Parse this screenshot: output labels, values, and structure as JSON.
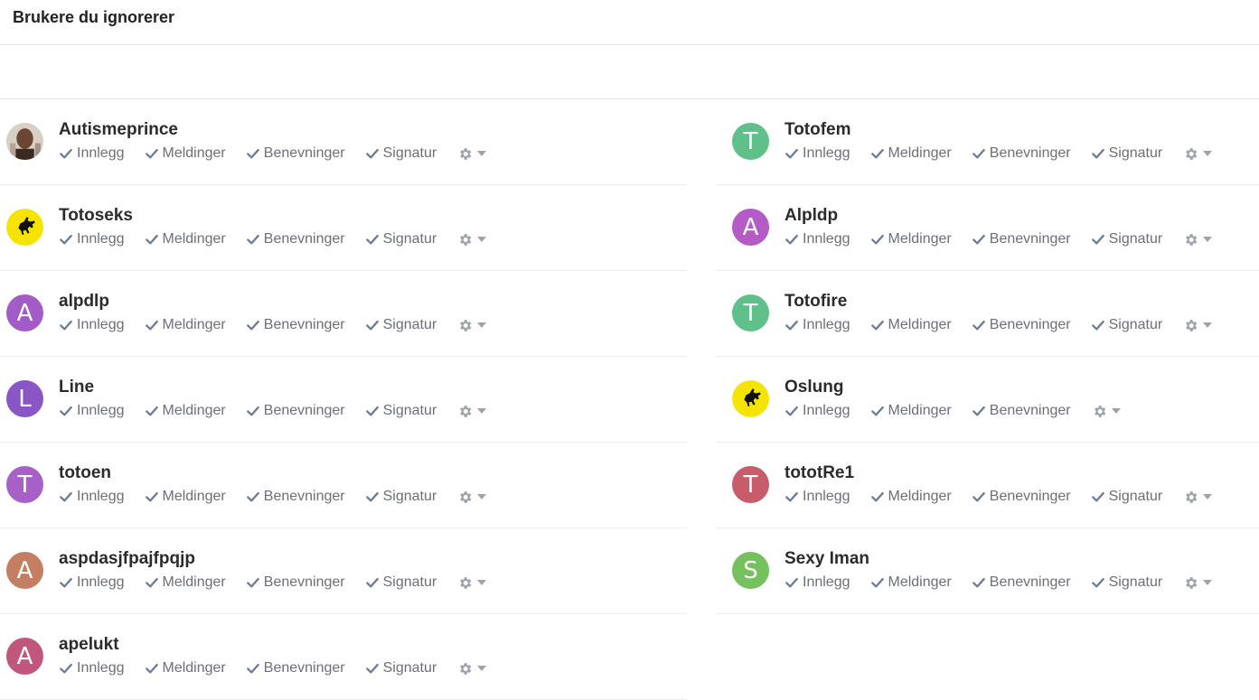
{
  "page_title": "Brukere du ignorerer",
  "colors": {
    "text": "#2b2b2b",
    "option": "#6c6f78",
    "divider": "#ececec"
  },
  "option_labels": {
    "posts": "Innlegg",
    "messages": "Meldinger",
    "mentions": "Benevninger",
    "signature": "Signatur"
  },
  "left_users": [
    {
      "name": "Autismeprince",
      "avatar_type": "photo",
      "letter": "",
      "color": "#8a6a55",
      "options": [
        "Innlegg",
        "Meldinger",
        "Benevninger",
        "Signatur"
      ]
    },
    {
      "name": "Totoseks",
      "avatar_type": "logo",
      "letter": "",
      "color": "#f5e400",
      "options": [
        "Innlegg",
        "Meldinger",
        "Benevninger",
        "Signatur"
      ]
    },
    {
      "name": "alpdlp",
      "avatar_type": "letter",
      "letter": "A",
      "color": "#a25bc7",
      "options": [
        "Innlegg",
        "Meldinger",
        "Benevninger",
        "Signatur"
      ]
    },
    {
      "name": "Line",
      "avatar_type": "letter",
      "letter": "L",
      "color": "#8a55c4",
      "options": [
        "Innlegg",
        "Meldinger",
        "Benevninger",
        "Signatur"
      ]
    },
    {
      "name": "totoen",
      "avatar_type": "letter",
      "letter": "T",
      "color": "#a860c9",
      "options": [
        "Innlegg",
        "Meldinger",
        "Benevninger",
        "Signatur"
      ]
    },
    {
      "name": "aspdasjfpajfpqjp",
      "avatar_type": "letter",
      "letter": "A",
      "color": "#c47e62",
      "options": [
        "Innlegg",
        "Meldinger",
        "Benevninger",
        "Signatur"
      ]
    },
    {
      "name": "apelukt",
      "avatar_type": "letter",
      "letter": "A",
      "color": "#c2577d",
      "options": [
        "Innlegg",
        "Meldinger",
        "Benevninger",
        "Signatur"
      ]
    }
  ],
  "right_users": [
    {
      "name": "Totofem",
      "avatar_type": "letter",
      "letter": "T",
      "color": "#5fc08a",
      "options": [
        "Innlegg",
        "Meldinger",
        "Benevninger",
        "Signatur"
      ]
    },
    {
      "name": "Alpldp",
      "avatar_type": "letter",
      "letter": "A",
      "color": "#b45bc6",
      "options": [
        "Innlegg",
        "Meldinger",
        "Benevninger",
        "Signatur"
      ]
    },
    {
      "name": "Totofire",
      "avatar_type": "letter",
      "letter": "T",
      "color": "#5fc08a",
      "options": [
        "Innlegg",
        "Meldinger",
        "Benevninger",
        "Signatur"
      ]
    },
    {
      "name": "Oslung",
      "avatar_type": "logo",
      "letter": "",
      "color": "#f5e400",
      "options": [
        "Innlegg",
        "Meldinger",
        "Benevninger"
      ]
    },
    {
      "name": "tototRe1",
      "avatar_type": "letter",
      "letter": "T",
      "color": "#c75c6a",
      "options": [
        "Innlegg",
        "Meldinger",
        "Benevninger",
        "Signatur"
      ]
    },
    {
      "name": "Sexy Iman",
      "avatar_type": "letter",
      "letter": "S",
      "color": "#74c15e",
      "options": [
        "Innlegg",
        "Meldinger",
        "Benevninger",
        "Signatur"
      ]
    }
  ]
}
